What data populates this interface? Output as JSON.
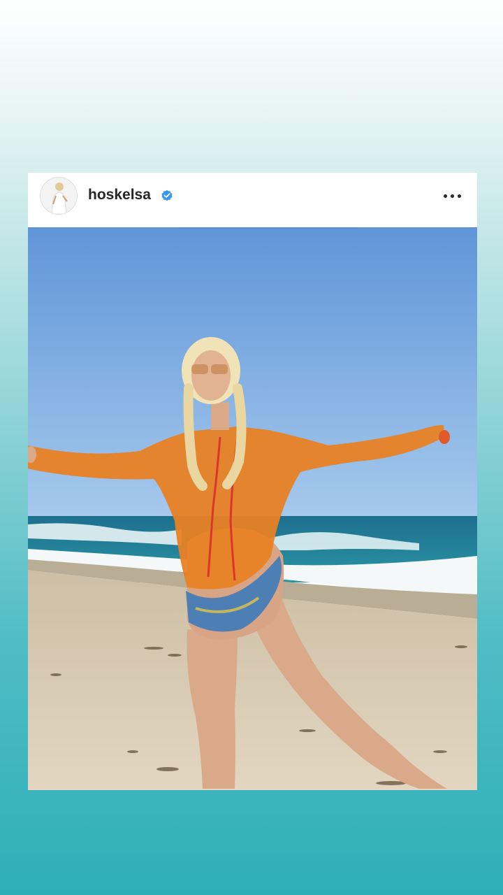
{
  "post": {
    "username": "hoskelsa",
    "verified_icon": "verified-badge-icon",
    "more_icon": "more-horizontal-icon",
    "colors": {
      "verified": "#3897F0",
      "sky_top": "#5f95d8",
      "sky_bottom": "#9cc2ea",
      "ocean": "#1f7f97",
      "sand": "#d8cbb3",
      "top": "#e88124"
    }
  }
}
